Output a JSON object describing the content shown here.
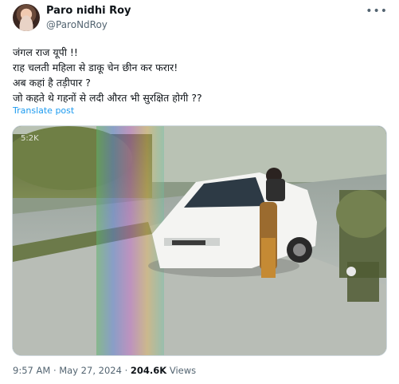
{
  "author": {
    "name": "Paro nidhi Roy",
    "handle": "@ParoNdRoy",
    "avatar_icon": "profile-photo"
  },
  "more_icon": "ellipsis-icon",
  "post": {
    "text": "जंगल राज यूपी !!\n राह चलती महिला से डाकू चेन छीन कर फरार!\nअब कहां है तड़ीपार ?\nजो कहते थे गहनों से लदी औरत भी सुरक्षित होगी ??",
    "translate_label": "Translate post"
  },
  "video": {
    "overlay_text": "5:2K",
    "plate_text": "▪▪▪ ▪▪"
  },
  "footer": {
    "time": "9:57 AM",
    "separator": "·",
    "date": "May 27, 2024",
    "views_count": "204.6K",
    "views_label": "Views"
  },
  "colors": {
    "link": "#1d9bf0",
    "secondary_text": "#536471",
    "primary_text": "#0f1419"
  }
}
